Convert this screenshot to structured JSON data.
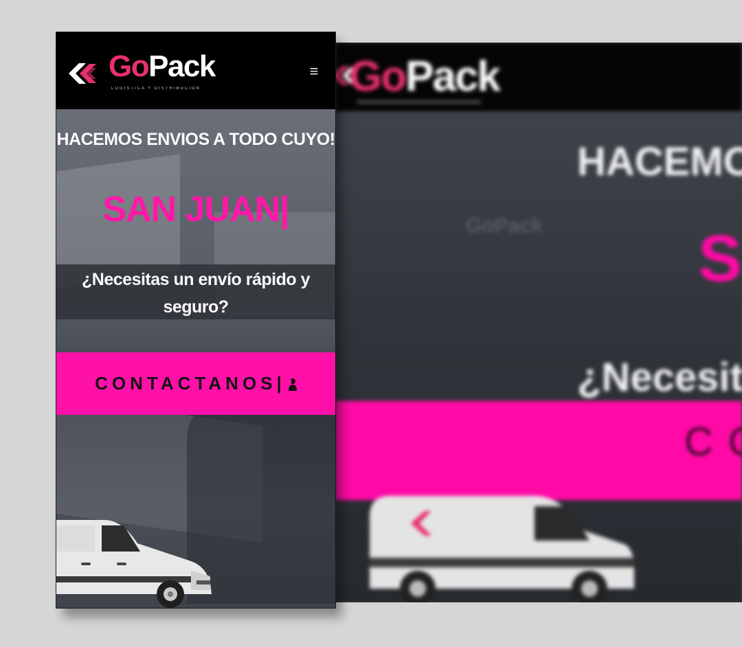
{
  "brand": {
    "logo_go": "Go",
    "logo_pack": "Pack",
    "tagline": "LOGISTICA Y DISTRIBUCION",
    "accent_color": "#ff10a8",
    "logo_accent_color": "#e8306e"
  },
  "header": {
    "menu_icon": "hamburger-icon",
    "menu_glyph": "≡"
  },
  "hero": {
    "headline": "HACEMOS ENVIOS A TODO CUYO!",
    "city": "SAN JUAN|",
    "question": "¿Necesitas un envío rápido y seguro?",
    "cta_label": "CONTACTANOS|",
    "cta_icon": "contact-person-icon"
  },
  "desktop_preview": {
    "logo_go": "Go",
    "logo_pack": "Pack",
    "headline_visible": "HACEMO",
    "city_visible": "S",
    "question_visible": "¿Necesita",
    "cta_visible": "CO"
  }
}
